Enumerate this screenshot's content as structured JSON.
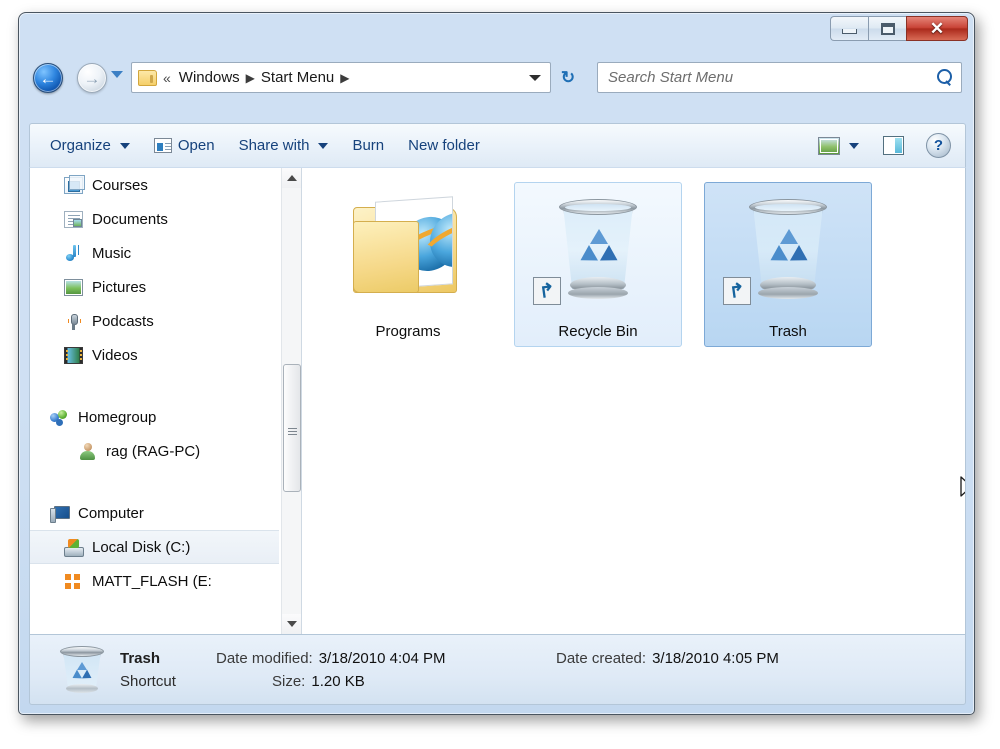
{
  "window": {
    "minimize_label": "Minimize",
    "maximize_label": "Maximize",
    "close_label": "Close",
    "close_glyph": "✕"
  },
  "navigation": {
    "back_label": "Back",
    "back_glyph": "←",
    "forward_label": "Forward",
    "forward_glyph": "→",
    "recent_pages_label": "Recent pages"
  },
  "address_bar": {
    "chevrons": "«",
    "crumbs": [
      {
        "label": "Windows",
        "separator": "▶"
      },
      {
        "label": "Start Menu",
        "separator": "▶"
      }
    ],
    "dropdown_label": "Previous locations",
    "refresh_label": "Refresh",
    "refresh_glyph": "↻"
  },
  "search": {
    "placeholder": "Search Start Menu",
    "value": "",
    "icon": "search-icon"
  },
  "toolbar": {
    "organize_label": "Organize",
    "open_label": "Open",
    "share_with_label": "Share with",
    "burn_label": "Burn",
    "new_folder_label": "New folder",
    "change_view_label": "Change your view",
    "preview_pane_label": "Show the preview pane",
    "help_label": "Get help",
    "help_glyph": "?"
  },
  "navigation_pane": {
    "groups": [
      {
        "items": [
          {
            "label": "Courses",
            "icon": "courses-icon",
            "indent": 1,
            "selected": false
          },
          {
            "label": "Documents",
            "icon": "documents-icon",
            "indent": 1,
            "selected": false
          },
          {
            "label": "Music",
            "icon": "music-icon",
            "indent": 1,
            "selected": false
          },
          {
            "label": "Pictures",
            "icon": "pictures-icon",
            "indent": 1,
            "selected": false
          },
          {
            "label": "Podcasts",
            "icon": "podcasts-icon",
            "indent": 1,
            "selected": false
          },
          {
            "label": "Videos",
            "icon": "videos-icon",
            "indent": 1,
            "selected": false
          }
        ]
      },
      {
        "items": [
          {
            "label": "Homegroup",
            "icon": "homegroup-icon",
            "indent": 0,
            "selected": false
          },
          {
            "label": "rag (RAG-PC)",
            "icon": "user-icon",
            "indent": 2,
            "selected": false
          }
        ]
      },
      {
        "items": [
          {
            "label": "Computer",
            "icon": "computer-icon",
            "indent": 0,
            "selected": false
          },
          {
            "label": "Local Disk (C:)",
            "icon": "hard-disk-icon",
            "indent": 1,
            "selected": true
          },
          {
            "label": "MATT_FLASH (E:",
            "icon": "flash-drive-icon",
            "indent": 1,
            "selected": false
          }
        ]
      }
    ],
    "scrollbar": {
      "up_label": "Scroll up",
      "down_label": "Scroll down"
    }
  },
  "content": {
    "items": [
      {
        "label": "Programs",
        "icon": "folder-internet-explorer-icon",
        "state": "normal",
        "shortcut": false
      },
      {
        "label": "Recycle Bin",
        "icon": "recycle-bin-icon",
        "state": "hovered",
        "shortcut": true
      },
      {
        "label": "Trash",
        "icon": "recycle-bin-icon",
        "state": "selected",
        "shortcut": true
      }
    ]
  },
  "details_pane": {
    "icon": "recycle-bin-icon",
    "name": "Trash",
    "type": "Shortcut",
    "date_modified_label": "Date modified:",
    "date_modified_value": "3/18/2010 4:04 PM",
    "date_created_label": "Date created:",
    "date_created_value": "3/18/2010 4:05 PM",
    "size_label": "Size:",
    "size_value": "1.20 KB"
  },
  "colors": {
    "frame": "#cfe0f3",
    "accent_blue": "#16427c",
    "selection": "#b8d6f2",
    "hover": "#e2eefb",
    "close_red": "#c94437"
  }
}
